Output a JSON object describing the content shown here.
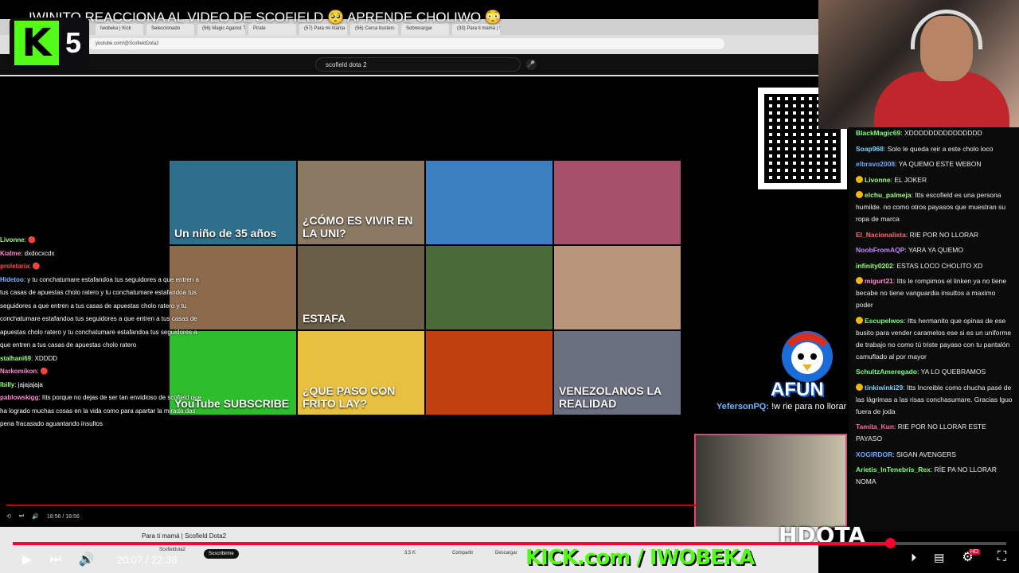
{
  "stream": {
    "title": "IWINITO REACCIONA AL VIDEO DE SCOFIELD 🥺 APRENDE CHOLIWO 😳",
    "kick_badge_number": "5",
    "kick_url": "KICK.com / IWOBEKA",
    "hdota": "HDOTA",
    "mascot_text": "AFUN"
  },
  "browser": {
    "tabs": [
      "Iwobeka | Kick",
      "Seleccionado",
      "(56) Magic Against The Machine",
      "Pirate",
      "(57) Para mi mama",
      "(56) Cerca busters",
      "Sobrecargar",
      "(33) Para ti mama | Scofield Dota"
    ],
    "address": "youtube.com/@ScofieldDota2",
    "search_value": "scofield dota 2",
    "inner_video_title": "Para ti mamá | Scofield Dota2",
    "inner_channel": "Scofieldota2",
    "inner_subscribe": "Suscribirme",
    "inner_likes": "3,5 K",
    "inner_share": "Compartir",
    "inner_download": "Descargar",
    "inner_time": "18:56 / 18:56"
  },
  "thumbs": [
    {
      "text": "Un niño de 35 años",
      "bg": "#2e6f8c"
    },
    {
      "text": "¿CÓMO ES VIVIR EN LA UNI?",
      "bg": "#8a7a64"
    },
    {
      "text": "",
      "bg": "#3b7fc0"
    },
    {
      "text": "",
      "bg": "#a4506b"
    },
    {
      "text": "",
      "bg": "#8c6a4c"
    },
    {
      "text": "ESTAFA",
      "bg": "#6b5e48"
    },
    {
      "text": "",
      "bg": "#4a6a38"
    },
    {
      "text": "",
      "bg": "#b89478"
    },
    {
      "text": "YouTube SUBSCRIBE",
      "bg": "#2dbd2d"
    },
    {
      "text": "¿QUE PASO CON FRITO LAY?",
      "bg": "#e8c040"
    },
    {
      "text": "",
      "bg": "#c04010"
    },
    {
      "text": "VENEZOLANOS LA REALIDAD",
      "bg": "#6a7080"
    }
  ],
  "left_chat": [
    {
      "user": "Livonne",
      "color": "#9aff7a",
      "text": "🔴"
    },
    {
      "user": "Kialme",
      "color": "#ff8ad0",
      "text": "dxdocxcdx"
    },
    {
      "user": "proletaria",
      "color": "#ff5050",
      "text": "🔴"
    },
    {
      "user": "Hidetoo",
      "color": "#7ab8ff",
      "text": "y tu conchatumare estafandoa tus seguidores a que entren a tus casas de apuestas cholo ratero y tu conchatumare estafandoa tus seguidores a que entren a tus casas de apuestas cholo ratero y tu conchatumare estafandoa tus seguidores a que entren a tus casas de apuestas cholo ratero y tu conchatumare estafandoa tus seguidores a que entren a tus casas de apuestas cholo ratero"
    },
    {
      "user": "stalhani69",
      "color": "#9aff7a",
      "text": "XDDDD"
    },
    {
      "user": "Narkomikon",
      "color": "#ff8ad0",
      "text": "🔴"
    },
    {
      "user": "lbilly",
      "color": "#9aff7a",
      "text": "jajajajaja"
    },
    {
      "user": "pablowskigg",
      "color": "#ff8ad0",
      "text": "Itts porque no dejas de ser tan envidioso de scofield que ha logrado muchas cosas en la vida como para apartar la mirada das pena fracasado aguantando insultos"
    }
  ],
  "chat": [
    {
      "user": "BlackMagic69",
      "color": "#7aff7a",
      "text": "XDDDDDDDDDDDDDDD"
    },
    {
      "user": "Soap968",
      "color": "#7ad4ff",
      "text": "Solo le queda reir a este cholo loco"
    },
    {
      "user": "elbravo2008",
      "color": "#6ca8ff",
      "text": "YA QUEMO ESTE WEBON"
    },
    {
      "user": "Livonne",
      "color": "#9aff7a",
      "text": "EL JOKER",
      "badge": true
    },
    {
      "user": "elchu_palmeja",
      "color": "#9aff7a",
      "text": "Itts escofield es una persona humilde. no como otros payasos que muestran su ropa de marca",
      "badge": true
    },
    {
      "user": "El_Nacionalista",
      "color": "#ff6a6a",
      "text": "RIE POR NO LLORAR"
    },
    {
      "user": "NoobFromAQP",
      "color": "#c08aff",
      "text": "YARA YA QUEMO"
    },
    {
      "user": "infinity0202",
      "color": "#9aff7a",
      "text": "ESTAS LOCO CHOLITO XD"
    },
    {
      "user": "migurt21",
      "color": "#ff8ad0",
      "text": "Itts le rompimos el linken ya no tiene becabe no tiene vanguardia insultos a maximo poder",
      "badge": true
    },
    {
      "user": "Escupelwos",
      "color": "#7aff7a",
      "text": "Itts hermanito que opinas de ese busito para vender caramelos ese si es un uniforme de trabajo no como tú triste payaso con tu pantalón camuflado al por mayor",
      "badge": true
    },
    {
      "user": "SchultzAmeregado",
      "color": "#7aff7a",
      "text": "YA LO QUEBRAMOS"
    },
    {
      "user": "tinkiwinki29",
      "color": "#7ad4ff",
      "text": "Itts Increible como chucha pasé de las lágrimas a las risas conchasumare. Gracias lguo fuera de joda",
      "badge": true
    },
    {
      "user": "Tamita_Kun",
      "color": "#ff6a9a",
      "text": "RIE POR NO LLORAR ESTE PAYASO"
    },
    {
      "user": "XOGIRDOR",
      "color": "#6ca8ff",
      "text": "SIGAN AVENGERS"
    },
    {
      "user": "Arietis_InTenebris_Rex",
      "color": "#7aff7a",
      "text": "RÍE PA NO LLORAR NOMA"
    }
  ],
  "highlight": {
    "user": "YefersonPQ",
    "text": "!w rie para no llorar"
  },
  "player": {
    "current": "20:07",
    "total": "22:38",
    "progress": 0.883,
    "accent": "#ff0033"
  }
}
